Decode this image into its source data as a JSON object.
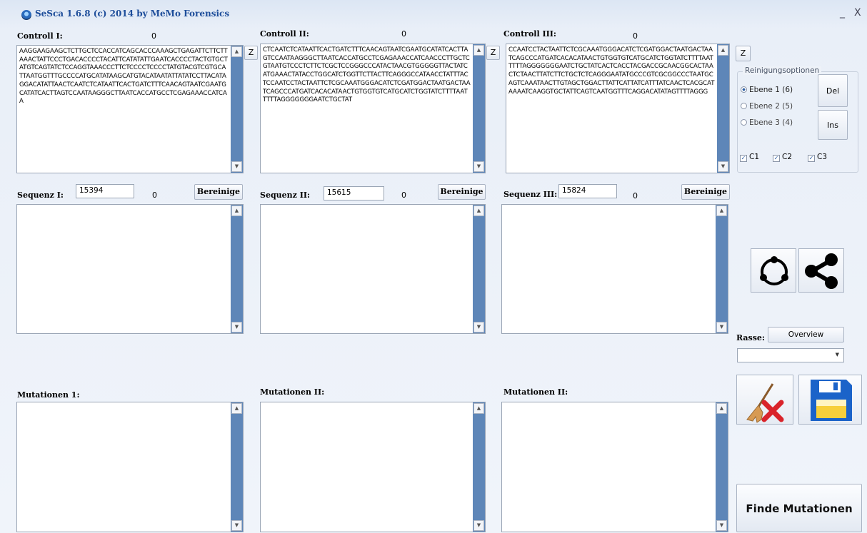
{
  "window": {
    "title": "SeSca 1.6.8 (c) 2014 by MeMo Forensics",
    "minimize": "_",
    "close": "X"
  },
  "controls": [
    {
      "label": "Controll I:",
      "count": "0",
      "z_label": "Z",
      "cursor_prefix": "AAGGAAG",
      "text": "AAGGAAGAAGCTCTTGCTCCACCATCAGCACCCAAAGCTGAGATTCTTCTTAAACTATTCCCTGACACCCCTACATTCATATATTGAATCACCCCTACTGTGCTATGTCAGTATCTCCAGGTAAACCCTTCTCCCCTCCCCTATGTACGTCGTGCATTAATGGTTTGCCCCATGCATATAAGCATGTACATAATATTATATCCTTACATAGGACATATTAACTCAATCTCATAATTCACTGATCTTTCAACAGTAATCGAATGCATATCACTTAGTCCAATAAGGGCTTAATCACCATGCCTCGAGAAACCATCAA"
    },
    {
      "label": "Controll II:",
      "count": "0",
      "z_label": "Z",
      "text": "CTCAATCTCATAATTCACTGATCTTTCAACAGTAATCGAATGCATATCACTTAGTCCAATAAGGGCTTAATCACCATGCCTCGAGAAACCATCAACCCTTGCTCGTAATGTCCCTCTTCTCGCTCCGGGCCCATACTAACGTGGGGGTTACTATCATGAAACTATACCTGGCATCTGGTTCTTACTTCAGGGCCATAACCTATTTACTCCAATCCTACTAATTCTCGCAAATGGGACATCTCGATGGACTAATGACTAATCAGCCCATGATCACACATAACTGTGGTGTCATGCATCTGGTATCTTTTAATTTTTAGGGGGGGAATCTGCTAT"
    },
    {
      "label": "Controll III:",
      "count": "0",
      "z_label": "Z",
      "text": "CCAATCCTACTAATTCTCGCAAATGGGACATCTCGATGGACTAATGACTAATCAGCCCATGATCACACATAACTGTGGTGTCATGCATCTGGTATCTTTTAATTTTTAGGGGGGGAATCTGCTATCACTCACCTACGACCGCAACGGCACTAACTCTAACTTATCTTCTGCTCTCAGGGAATATGCCCGTCGCGGCCCTAATGCAGTCAAATAACTTGTAGCTGGACTTATTCATTATCATTTATCAACTCACGCATAAAATCAAGGTGCTATTCAGTCAATGGTTTCAGGACATATAGTTTTAGGG"
    }
  ],
  "sequences": [
    {
      "label": "Sequenz I:",
      "value": "15394",
      "count": "0",
      "button": "Bereinige"
    },
    {
      "label": "Sequenz II:",
      "value": "15615",
      "count": "0",
      "button": "Bereinige"
    },
    {
      "label": "Sequenz III:",
      "value": "15824",
      "count": "0",
      "button": "Bereinige"
    }
  ],
  "mutations": [
    {
      "label": "Mutationen 1:"
    },
    {
      "label": "Mutationen II:"
    },
    {
      "label": "Mutationen II:"
    }
  ],
  "options": {
    "group_title": "Reinigungsoptionen",
    "radios": [
      {
        "label": "Ebene 1 (6)",
        "selected": true
      },
      {
        "label": "Ebene 2 (5)",
        "selected": false
      },
      {
        "label": "Ebene 3 (4)",
        "selected": false
      }
    ],
    "del_label": "Del",
    "ins_label": "Ins",
    "checks": [
      {
        "label": "C1",
        "checked": true
      },
      {
        "label": "C2",
        "checked": true
      },
      {
        "label": "C3",
        "checked": true
      }
    ]
  },
  "icons": {
    "circle": "circle-nodes-icon",
    "share": "share-icon",
    "clear": "broom-clear-icon",
    "save": "floppy-save-icon"
  },
  "rasse": {
    "label": "Rasse:",
    "overview": "Overview",
    "selected": ""
  },
  "find_button": "Finde Mutationen",
  "colors": {
    "scrollbar": "#5e86b8",
    "title": "#1d4d9a",
    "save_blue": "#1b63c9",
    "clear_red": "#d9232a"
  }
}
